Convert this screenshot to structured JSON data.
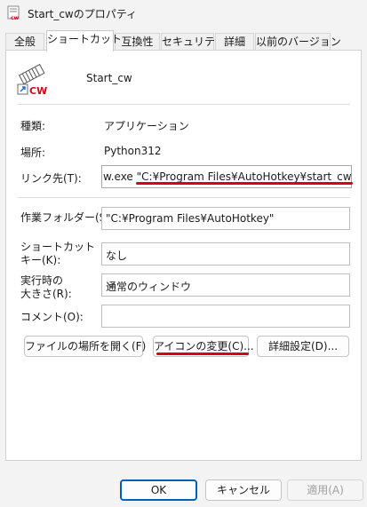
{
  "window": {
    "title": "Start_cwのプロパティ"
  },
  "tabs": [
    {
      "label": "全般"
    },
    {
      "label": "ショートカット"
    },
    {
      "label": "互換性"
    },
    {
      "label": "セキュリティ"
    },
    {
      "label": "詳細"
    },
    {
      "label": "以前のバージョン"
    }
  ],
  "shortcut": {
    "name": "Start_cw",
    "icon_name": "cw-shortcut-icon",
    "icon_text": "CW"
  },
  "fields": {
    "type_label": "種類:",
    "type_value": "アプリケーション",
    "location_label": "場所:",
    "location_value": "Python312",
    "target_label": "リンク先(T):",
    "target_value": "w.exe \"C:¥Program Files¥AutoHotkey¥start_cw.pyw\"",
    "workdir_label": "作業フォルダー(S):",
    "workdir_value": "\"C:¥Program Files¥AutoHotkey\"",
    "hotkey_label_line1": "ショートカット",
    "hotkey_label_line2": "キー(K):",
    "hotkey_value": "なし",
    "run_label_line1": "実行時の",
    "run_label_line2": "大きさ(R):",
    "run_value": "通常のウィンドウ",
    "comment_label": "コメント(O):",
    "comment_value": ""
  },
  "buttons": {
    "open_location": "ファイルの場所を開く(F)",
    "change_icon": "アイコンの変更(C)...",
    "advanced": "詳細設定(D)...",
    "ok": "OK",
    "cancel": "キャンセル",
    "apply": "適用(A)"
  },
  "colors": {
    "highlight": "#d4001a",
    "accent": "#005fb8"
  }
}
